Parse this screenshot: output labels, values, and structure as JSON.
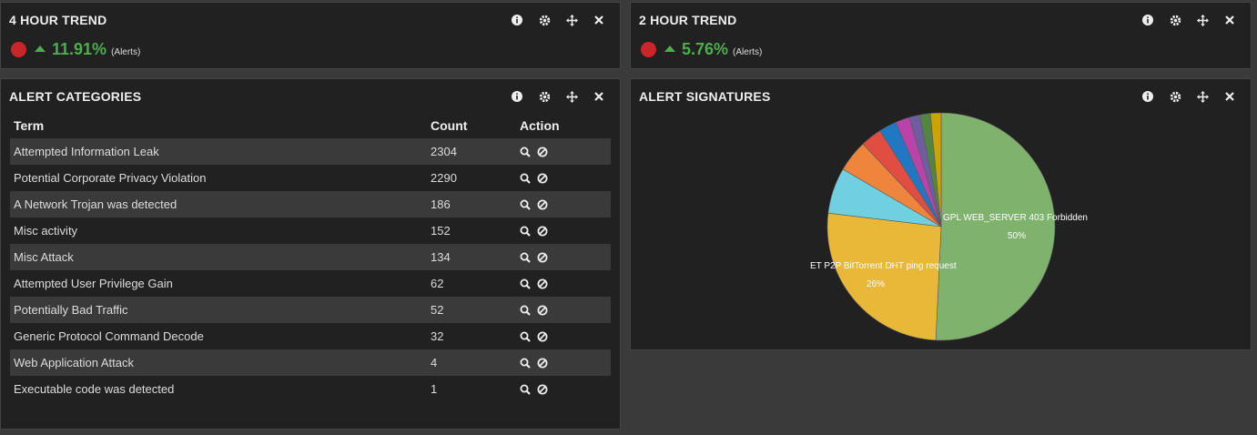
{
  "trend4": {
    "title": "4 HOUR TREND",
    "percent": "11.91%",
    "unit": "(Alerts)"
  },
  "trend2": {
    "title": "2 HOUR TREND",
    "percent": "5.76%",
    "unit": "(Alerts)"
  },
  "categories": {
    "title": "ALERT CATEGORIES",
    "headers": {
      "term": "Term",
      "count": "Count",
      "action": "Action"
    },
    "rows": [
      {
        "term": "Attempted Information Leak",
        "count": "2304"
      },
      {
        "term": "Potential Corporate Privacy Violation",
        "count": "2290"
      },
      {
        "term": "A Network Trojan was detected",
        "count": "186"
      },
      {
        "term": "Misc activity",
        "count": "152"
      },
      {
        "term": "Misc Attack",
        "count": "134"
      },
      {
        "term": "Attempted User Privilege Gain",
        "count": "62"
      },
      {
        "term": "Potentially Bad Traffic",
        "count": "52"
      },
      {
        "term": "Generic Protocol Command Decode",
        "count": "32"
      },
      {
        "term": "Web Application Attack",
        "count": "4"
      },
      {
        "term": "Executable code was detected",
        "count": "1"
      }
    ]
  },
  "signatures": {
    "title": "ALERT SIGNATURES"
  },
  "chart_data": {
    "type": "pie",
    "slices": [
      {
        "label": "GPL WEB_SERVER 403 Forbidden",
        "percent_label": "50%",
        "value": 50.5,
        "color": "#7eb26d"
      },
      {
        "label": "ET P2P BitTorrent DHT ping request",
        "percent_label": "26%",
        "value": 26,
        "color": "#eab839"
      },
      {
        "label": "",
        "value": 6.5,
        "color": "#6ed0e0"
      },
      {
        "label": "",
        "value": 4.5,
        "color": "#ef843c"
      },
      {
        "label": "",
        "value": 3,
        "color": "#e24d42"
      },
      {
        "label": "",
        "value": 2.5,
        "color": "#1f78c1"
      },
      {
        "label": "",
        "value": 2,
        "color": "#ba43a9"
      },
      {
        "label": "",
        "value": 1.5,
        "color": "#705da0"
      },
      {
        "label": "",
        "value": 1.5,
        "color": "#508642"
      },
      {
        "label": "",
        "value": 1.5,
        "color": "#cca300"
      }
    ]
  },
  "colors": {
    "status_dot": "#c9262a",
    "trend_up": "#4cae4c",
    "panel_bg": "#212121",
    "page_bg": "#3a3a3a"
  },
  "icons": [
    "info-icon",
    "gear-icon",
    "move-icon",
    "close-icon",
    "search-icon",
    "ban-icon"
  ]
}
